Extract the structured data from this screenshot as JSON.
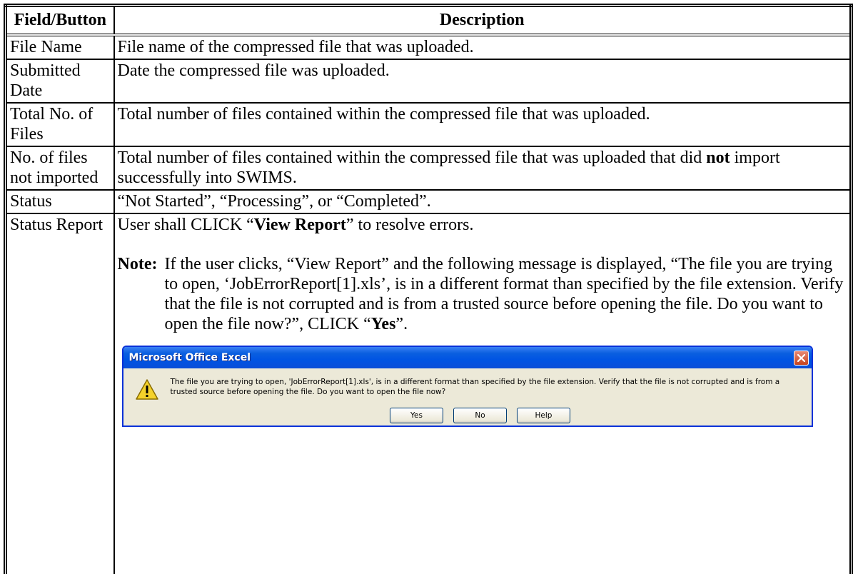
{
  "table": {
    "headers": [
      "Field/Button",
      "Description"
    ],
    "rows": [
      {
        "field": "File Name",
        "description": "File name of the compressed file that was uploaded."
      },
      {
        "field": "Submitted Date",
        "description": "Date the compressed file was uploaded."
      },
      {
        "field": "Total No. of Files",
        "description": "Total number of files contained within the compressed file that was uploaded."
      },
      {
        "field": "No. of files not imported",
        "description_pre": "Total number of files contained within the compressed file that was uploaded that did ",
        "description_bold": "not",
        "description_post": " import successfully into SWIMS."
      },
      {
        "field": "Status",
        "description": "“Not Started”, “Processing”, or “Completed”."
      },
      {
        "field": "Status Report",
        "description_pre": "User shall CLICK “",
        "description_bold": "View Report",
        "description_post": "” to resolve errors."
      }
    ]
  },
  "note": {
    "label": "Note:",
    "text_pre": "If the user clicks, “View Report” and the following message is displayed, “The file you are trying to open, ‘JobErrorReport[1].xls’, is in a different format than specified by the file extension.  Verify that the file is not corrupted and is from a trusted source before opening the file. Do you want to open the file now?”, CLICK “",
    "text_bold": "Yes",
    "text_post": "”."
  },
  "dialog": {
    "title": "Microsoft Office Excel",
    "message": "The file you are trying to open, 'JobErrorReport[1].xls', is in a different format than specified by the file extension. Verify that the file is not corrupted and is from a trusted source before opening the file. Do you want to open the file now?",
    "buttons": {
      "yes": "Yes",
      "no": "No",
      "help": "Help"
    },
    "icon": "warning-icon",
    "close_icon": "close-icon",
    "colors": {
      "titlebar": "#0054e3",
      "body": "#ece9d8",
      "close": "#c5431e"
    }
  }
}
